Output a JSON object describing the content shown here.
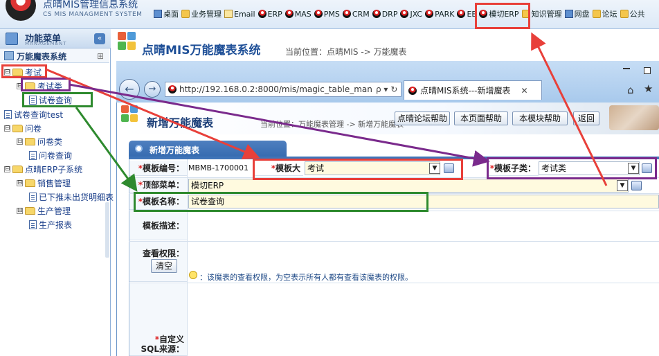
{
  "top": {
    "logo_title": "点晴MIS管理信息系统",
    "logo_sub": "CS MIS MANAGMENT SYSTEM",
    "nav": [
      {
        "label": "桌面",
        "icon": "monitor-icon"
      },
      {
        "label": "业务管理",
        "icon": "folder-icon"
      },
      {
        "label": "Email",
        "icon": "mail-icon"
      },
      {
        "label": "ERP",
        "icon": "ball-icon"
      },
      {
        "label": "MAS",
        "icon": "ball-icon"
      },
      {
        "label": "PMS",
        "icon": "ball-icon"
      },
      {
        "label": "CRM",
        "icon": "ball-icon"
      },
      {
        "label": "DRP",
        "icon": "ball-icon"
      },
      {
        "label": "JXC",
        "icon": "ball-icon"
      },
      {
        "label": "PARK",
        "icon": "ball-icon"
      },
      {
        "label": "EE",
        "icon": "ball-icon"
      },
      {
        "label": "模切ERP",
        "icon": "ball-icon"
      },
      {
        "label": "知识管理",
        "icon": "book-icon"
      },
      {
        "label": "网盘",
        "icon": "drive-icon"
      },
      {
        "label": "论坛",
        "icon": "forum-icon"
      },
      {
        "label": "公共",
        "icon": "people-icon"
      }
    ]
  },
  "left": {
    "menu_title": "功能菜单",
    "menu_sub": "MANAGEMENT",
    "collapse_label": "«",
    "tree_header": "万能魔表系统",
    "tree": [
      {
        "label": "考试",
        "type": "folder",
        "toggle": "⊟"
      },
      {
        "label": "考试类",
        "type": "folder",
        "toggle": "⊟"
      },
      {
        "label": "试卷查询",
        "type": "doc"
      },
      {
        "label": "试卷查询test",
        "type": "doc"
      },
      {
        "label": "问卷",
        "type": "folder",
        "toggle": "⊟"
      },
      {
        "label": "问卷类",
        "type": "folder",
        "toggle": "⊟"
      },
      {
        "label": "问卷查询",
        "type": "doc"
      },
      {
        "label": "点晴ERP子系统",
        "type": "folder",
        "toggle": "⊟"
      },
      {
        "label": "销售管理",
        "type": "folder",
        "toggle": "⊟"
      },
      {
        "label": "已下推未出货明细表",
        "type": "doc"
      },
      {
        "label": "生产管理",
        "type": "folder",
        "toggle": "⊟"
      },
      {
        "label": "生产报表",
        "type": "doc"
      }
    ]
  },
  "main": {
    "title": "点晴MIS万能魔表系统",
    "crumb": "当前位置：点晴MIS -> 万能魔表"
  },
  "browser": {
    "url": "http://192.168.0.2:8000/mis/magic_table_man",
    "url_tools": "ρ ▾ ↻",
    "tab_title": "点晴MIS系统---新增魔表",
    "tab_close": "✕",
    "back": "←",
    "forward": "→",
    "home": "⌂",
    "star": "★"
  },
  "page": {
    "title": "新增万能魔表",
    "crumb": "当前位置：万能魔表管理 -> 新增万能魔表",
    "buttons": [
      "点晴论坛帮助",
      "本页面帮助",
      "本模块帮助",
      "返回"
    ]
  },
  "form": {
    "panel_title": "新增万能魔表",
    "code_label": "模板编号：",
    "code_value": "MBMB-1700001",
    "category_label": "模板大类：",
    "category_value": "考试",
    "subcategory_label": "模板子类：",
    "subcategory_value": "考试类",
    "topmenu_label": "顶部菜单：",
    "topmenu_value": "模切ERP",
    "name_label": "模板名称：",
    "name_value": "试卷查询",
    "desc_label": "模板描述：",
    "perm_label": "查看权限：",
    "clear_button": "清空",
    "hint": "：该魔表的查看权限，为空表示所有人都有查看该魔表的权限。",
    "sql_label_1": "自定义",
    "sql_label_2": "SQL来源：",
    "required_mark": "*"
  },
  "colors": {
    "annot_red": "#e8403a",
    "annot_purple": "#7a2a8c",
    "annot_green": "#2e8a2e",
    "brand_blue": "#1e4f97"
  }
}
